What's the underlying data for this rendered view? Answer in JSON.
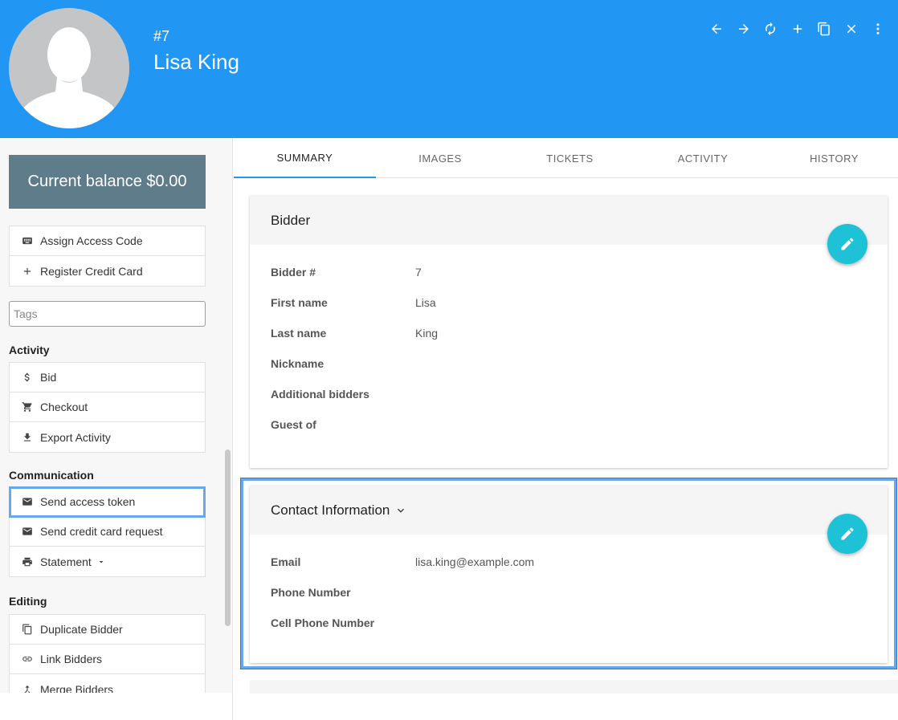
{
  "header": {
    "bidder_number": "#7",
    "bidder_name": "Lisa King",
    "toolbar": [
      "back-arrow-icon",
      "forward-arrow-icon",
      "refresh-icon",
      "add-icon",
      "copy-icon",
      "close-icon",
      "more-vert-icon"
    ]
  },
  "sidebar": {
    "balance": "Current balance $0.00",
    "top_actions": [
      {
        "label": "Assign Access Code",
        "icon": "keyboard-icon"
      },
      {
        "label": "Register Credit Card",
        "icon": "plus-icon"
      }
    ],
    "tags_placeholder": "Tags",
    "activity_title": "Activity",
    "activity": [
      {
        "label": "Bid",
        "icon": "dollar-icon"
      },
      {
        "label": "Checkout",
        "icon": "cart-icon"
      },
      {
        "label": "Export Activity",
        "icon": "download-icon"
      }
    ],
    "communication_title": "Communication",
    "communication": [
      {
        "label": "Send access token",
        "icon": "mail-icon"
      },
      {
        "label": "Send credit card request",
        "icon": "mail-icon"
      },
      {
        "label": "Statement",
        "icon": "printer-icon"
      }
    ],
    "editing_title": "Editing",
    "editing": [
      {
        "label": "Duplicate Bidder",
        "icon": "copy-icon"
      },
      {
        "label": "Link Bidders",
        "icon": "link-icon"
      },
      {
        "label": "Merge Bidders",
        "icon": "merge-icon"
      }
    ]
  },
  "tabs": [
    "SUMMARY",
    "IMAGES",
    "TICKETS",
    "ACTIVITY",
    "HISTORY"
  ],
  "bidder_card": {
    "title": "Bidder",
    "fields": [
      {
        "label": "Bidder #",
        "value": "7"
      },
      {
        "label": "First name",
        "value": "Lisa"
      },
      {
        "label": "Last name",
        "value": "King"
      },
      {
        "label": "Nickname",
        "value": ""
      },
      {
        "label": "Additional bidders",
        "value": ""
      },
      {
        "label": "Guest of",
        "value": ""
      }
    ]
  },
  "contact_card": {
    "title": "Contact Information",
    "fields": [
      {
        "label": "Email",
        "value": "lisa.king@example.com"
      },
      {
        "label": "Phone Number",
        "value": ""
      },
      {
        "label": "Cell Phone Number",
        "value": ""
      }
    ]
  },
  "colors": {
    "header": "#2196F3",
    "balance": "#5f7c8a",
    "fab": "#1ec2d6",
    "highlight": "#64a8ee"
  }
}
